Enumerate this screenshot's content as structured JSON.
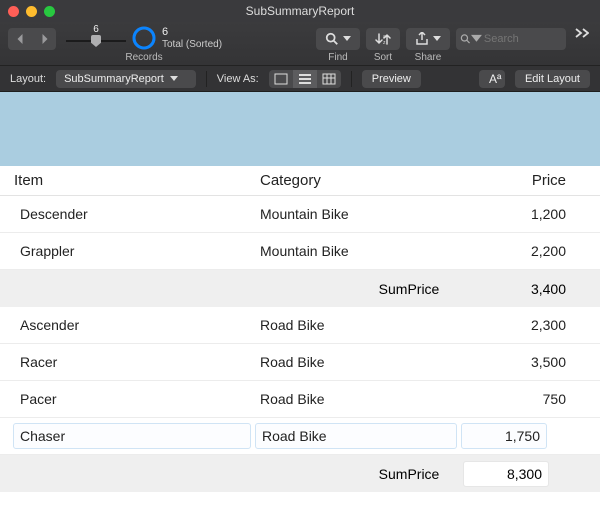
{
  "window": {
    "title": "SubSummaryReport"
  },
  "toolbar": {
    "records": {
      "current": "6",
      "total": "6",
      "status": "Total (Sorted)",
      "label": "Records"
    },
    "find_label": "Find",
    "sort_label": "Sort",
    "share_label": "Share",
    "search_placeholder": "Search"
  },
  "layoutbar": {
    "layout_label": "Layout:",
    "layout_value": "SubSummaryReport",
    "viewas_label": "View As:",
    "preview_label": "Preview",
    "text_icon": "Aª",
    "edit_label": "Edit Layout"
  },
  "columns": {
    "item": "Item",
    "category": "Category",
    "price": "Price"
  },
  "rows": [
    {
      "item": "Descender",
      "category": "Mountain Bike",
      "price": "1,200",
      "selected": false
    },
    {
      "item": "Grappler",
      "category": "Mountain Bike",
      "price": "2,200",
      "selected": false
    }
  ],
  "sum1": {
    "label": "SumPrice",
    "value": "3,400"
  },
  "rows2": [
    {
      "item": "Ascender",
      "category": "Road Bike",
      "price": "2,300",
      "selected": false
    },
    {
      "item": "Racer",
      "category": "Road Bike",
      "price": "3,500",
      "selected": false
    },
    {
      "item": "Pacer",
      "category": "Road Bike",
      "price": "750",
      "selected": false
    },
    {
      "item": "Chaser",
      "category": "Road Bike",
      "price": "1,750",
      "selected": true
    }
  ],
  "sum2": {
    "label": "SumPrice",
    "value": "8,300"
  }
}
